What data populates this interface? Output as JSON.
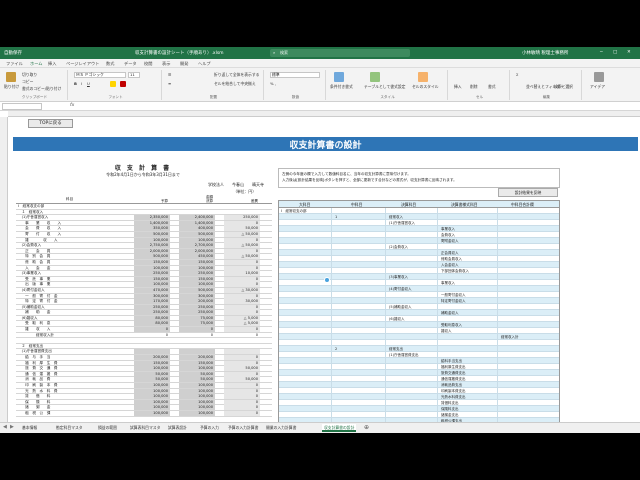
{
  "window": {
    "autosave": "自動保存",
    "title": "収支計算書の設計シート（手順あり）.xlsm",
    "search_placeholder": "検索",
    "user": "小林敏晴 税理士事務所"
  },
  "ribbon_tabs": [
    "ファイル",
    "ホーム",
    "挿入",
    "ページレイアウト",
    "数式",
    "データ",
    "校閲",
    "表示",
    "開発",
    "ヘルプ"
  ],
  "ribbon": {
    "paste": "貼り付け",
    "cut": "切り取り",
    "copy": "コピー",
    "format_painter": "書式のコピー/貼り付け",
    "clipboard": "クリップボード",
    "font_name": "ＭＳ Ｐゴシック",
    "font_size": "11",
    "font": "フォント",
    "wrap_text": "折り返して全体を表示する",
    "merge_center": "セルを結合して中央揃え",
    "alignment": "配置",
    "number_format": "標準",
    "number": "数値",
    "conditional_format": "条件付き書式",
    "format_as_table": "テーブルとして書式設定",
    "cell_styles": "セルのスタイル",
    "styles": "スタイル",
    "insert": "挿入",
    "delete": "削除",
    "format": "書式",
    "cells": "セル",
    "sort_filter": "並べ替えとフィルター",
    "find_select": "検索と選択",
    "editing": "編集",
    "ideas": "アイデア"
  },
  "formula_bar": {
    "fx": "fx"
  },
  "sheet": {
    "top_button": "TOPに戻る",
    "banner_title": "収支計算書の設計"
  },
  "report": {
    "title": "収 支 計 算 書",
    "period": "令和2年4月1日から令和3年3月31日まで",
    "org": "学校法人　　今春山　　晴天寺",
    "unit": "（単位：円）",
    "col_group": "金額",
    "col_item": "科目",
    "col1": "予算",
    "col2": "決算",
    "col3": "差異",
    "rows": [
      {
        "label": "Ⅰ　経常収支の部",
        "v1": "",
        "v2": "",
        "v3": "",
        "gray": false
      },
      {
        "label": "　１　経常収入",
        "v1": "",
        "v2": "",
        "v3": "",
        "gray": false
      },
      {
        "label": "　(1)庁舎運営収入",
        "v1": "2,350,000",
        "v2": "2,400,000",
        "v3": "250,000",
        "gray": true
      },
      {
        "label": "　　事　　業　　収　　入",
        "v1": "1,400,000",
        "v2": "1,400,000",
        "v3": "0",
        "gray": true
      },
      {
        "label": "　　会　　費　　収　　入",
        "v1": "350,000",
        "v2": "400,000",
        "v3": "50,000",
        "gray": true
      },
      {
        "label": "　　寄　　付　　収　　入",
        "v1": "500,000",
        "v2": "500,000",
        "v3": "△ 50,000",
        "gray": true
      },
      {
        "label": "　　雑　　　　収　　入",
        "v1": "100,000",
        "v2": "100,000",
        "v3": "0",
        "gray": true
      },
      {
        "label": "　(2)会費収入",
        "v1": "2,750,000",
        "v2": "2,700,000",
        "v3": "△ 50,000",
        "gray": true
      },
      {
        "label": "　　正　　会　　員",
        "v1": "2,000,000",
        "v2": "2,000,000",
        "v3": "0",
        "gray": true
      },
      {
        "label": "　　特　別　会　員",
        "v1": "500,000",
        "v2": "450,000",
        "v3": "△ 50,000",
        "gray": true
      },
      {
        "label": "　　賛　助　会　員",
        "v1": "150,000",
        "v2": "150,000",
        "v3": "0",
        "gray": true
      },
      {
        "label": "　　入　　会　　金",
        "v1": "100,000",
        "v2": "100,000",
        "v3": "0",
        "gray": true
      },
      {
        "label": "　(3)事業収入",
        "v1": "250,000",
        "v2": "250,000",
        "v3": "10,000",
        "gray": true
      },
      {
        "label": "　　受　託　事　業",
        "v1": "150,000",
        "v2": "150,000",
        "v3": "0",
        "gray": true
      },
      {
        "label": "　　出　版　事　業",
        "v1": "100,000",
        "v2": "100,000",
        "v3": "0",
        "gray": true
      },
      {
        "label": "　(4)寄付金収入",
        "v1": "470,000",
        "v2": "500,000",
        "v3": "△ 30,000",
        "gray": true
      },
      {
        "label": "　　一　般　寄　付　金",
        "v1": "300,000",
        "v2": "300,000",
        "v3": "0",
        "gray": true
      },
      {
        "label": "　　特　定　寄　付　金",
        "v1": "170,000",
        "v2": "200,000",
        "v3": "30,000",
        "gray": true
      },
      {
        "label": "　(5)補助金収入",
        "v1": "250,000",
        "v2": "250,000",
        "v3": "0",
        "gray": true
      },
      {
        "label": "　　補　　助　　金",
        "v1": "250,000",
        "v2": "250,000",
        "v3": "0",
        "gray": true
      },
      {
        "label": "　(6)雑収入",
        "v1": "80,000",
        "v2": "75,000",
        "v3": "△ 5,000",
        "gray": true
      },
      {
        "label": "　　受　取　利　息",
        "v1": "80,000",
        "v2": "75,000",
        "v3": "△ 5,000",
        "gray": true
      },
      {
        "label": "　　雑　　収　　入",
        "v1": "0",
        "v2": "0",
        "v3": "0",
        "gray": true
      },
      {
        "label": "　　　　　経常収入計",
        "v1": "0",
        "v2": "0",
        "v3": "0",
        "gray": false
      },
      {
        "label": "",
        "v1": "",
        "v2": "",
        "v3": "",
        "gray": false
      },
      {
        "label": "　２　経常支出",
        "v1": "",
        "v2": "",
        "v3": "",
        "gray": false
      },
      {
        "label": "　(1)庁舎運営費支出",
        "v1": "",
        "v2": "",
        "v3": "",
        "gray": true
      },
      {
        "label": "　　給　与　手　当",
        "v1": "200,000",
        "v2": "200,000",
        "v3": "0",
        "gray": true
      },
      {
        "label": "　　福　利　厚　生　費",
        "v1": "150,000",
        "v2": "150,000",
        "v3": "0",
        "gray": true
      },
      {
        "label": "　　旅　費　交　通　費",
        "v1": "100,000",
        "v2": "100,000",
        "v3": "50,000",
        "gray": true
      },
      {
        "label": "　　通　信　運　搬　費",
        "v1": "50,000",
        "v2": "50,000",
        "v3": "0",
        "gray": true
      },
      {
        "label": "　　消　耗　品　費",
        "v1": "50,000",
        "v2": "50,000",
        "v3": "50,000",
        "gray": true
      },
      {
        "label": "　　印　刷　製　本　費",
        "v1": "100,000",
        "v2": "100,000",
        "v3": "0",
        "gray": true
      },
      {
        "label": "　　光　熱　水　料　費",
        "v1": "100,000",
        "v2": "100,000",
        "v3": "0",
        "gray": true
      },
      {
        "label": "　　賃　　借　　料",
        "v1": "100,000",
        "v2": "100,000",
        "v3": "0",
        "gray": true
      },
      {
        "label": "　　保　　険　　料",
        "v1": "100,000",
        "v2": "100,000",
        "v3": "0",
        "gray": true
      },
      {
        "label": "　　諸　　謝　　金",
        "v1": "100,000",
        "v2": "100,000",
        "v3": "0",
        "gray": true
      },
      {
        "label": "　　租　税　公　課",
        "v1": "100,000",
        "v2": "100,000",
        "v3": "0",
        "gray": true
      }
    ]
  },
  "panel": {
    "note1": "左側の今年度の欄で入力して数値科目名に、当年の収支計算書に意味付けます。",
    "note2": "入力後は[設計結果を反映]ボタンを押すと、全部に更新です合計などの書式が、収支計算書に反映されます。",
    "apply_button": "設計結果を反映",
    "headers": [
      "大科目",
      "中科目",
      "決算科目",
      "決算書様式科目",
      "中科目合計欄"
    ],
    "rows": [
      {
        "c0": "Ⅰ　経常収支の部",
        "c1": "",
        "c2": "",
        "c3": "",
        "c4": "",
        "hl": false
      },
      {
        "c0": "",
        "c1": "1",
        "c2": "経常収入",
        "c3": "",
        "c4": "",
        "hl": true
      },
      {
        "c0": "",
        "c1": "",
        "c2": "(1)庁舎運営収入",
        "c3": "",
        "c4": "",
        "hl": false
      },
      {
        "c0": "",
        "c1": "",
        "c2": "",
        "c3": "事業収入",
        "c4": "",
        "hl": true
      },
      {
        "c0": "",
        "c1": "",
        "c2": "",
        "c3": "会費収入",
        "c4": "",
        "hl": false
      },
      {
        "c0": "",
        "c1": "",
        "c2": "",
        "c3": "寄附金収入",
        "c4": "",
        "hl": true
      },
      {
        "c0": "",
        "c1": "",
        "c2": "(2)会費収入",
        "c3": "",
        "c4": "",
        "hl": false
      },
      {
        "c0": "",
        "c1": "",
        "c2": "",
        "c3": "正会員収入",
        "c4": "",
        "hl": true
      },
      {
        "c0": "",
        "c1": "",
        "c2": "",
        "c3": "賛助会員収入",
        "c4": "",
        "hl": false
      },
      {
        "c0": "",
        "c1": "",
        "c2": "",
        "c3": "入会金収入",
        "c4": "",
        "hl": true
      },
      {
        "c0": "",
        "c1": "",
        "c2": "",
        "c3": "下部団体会費収入",
        "c4": "",
        "hl": false
      },
      {
        "c0": "",
        "c1": "",
        "c2": "(3)事業収入",
        "c3": "",
        "c4": "",
        "hl": true
      },
      {
        "c0": "",
        "c1": "",
        "c2": "",
        "c3": "事業収入",
        "c4": "",
        "hl": false
      },
      {
        "c0": "",
        "c1": "",
        "c2": "(4)寄付金収入",
        "c3": "",
        "c4": "",
        "hl": true
      },
      {
        "c0": "",
        "c1": "",
        "c2": "",
        "c3": "一般寄付金収入",
        "c4": "",
        "hl": false
      },
      {
        "c0": "",
        "c1": "",
        "c2": "",
        "c3": "特定寄付金収入",
        "c4": "",
        "hl": true
      },
      {
        "c0": "",
        "c1": "",
        "c2": "(5)補助金収入",
        "c3": "",
        "c4": "",
        "hl": false
      },
      {
        "c0": "",
        "c1": "",
        "c2": "",
        "c3": "補助金収入",
        "c4": "",
        "hl": true
      },
      {
        "c0": "",
        "c1": "",
        "c2": "(6)雑収入",
        "c3": "",
        "c4": "",
        "hl": false
      },
      {
        "c0": "",
        "c1": "",
        "c2": "",
        "c3": "受取利息収入",
        "c4": "",
        "hl": true
      },
      {
        "c0": "",
        "c1": "",
        "c2": "",
        "c3": "雑収入",
        "c4": "",
        "hl": false
      },
      {
        "c0": "",
        "c1": "",
        "c2": "",
        "c3": "",
        "c4": "経常収入計",
        "hl": true
      },
      {
        "c0": "",
        "c1": "",
        "c2": "",
        "c3": "",
        "c4": "",
        "hl": false
      },
      {
        "c0": "",
        "c1": "2",
        "c2": "経常支出",
        "c3": "",
        "c4": "",
        "hl": true
      },
      {
        "c0": "",
        "c1": "",
        "c2": "(1)庁舎運営費支出",
        "c3": "",
        "c4": "",
        "hl": false
      },
      {
        "c0": "",
        "c1": "",
        "c2": "",
        "c3": "給料手当支出",
        "c4": "",
        "hl": true
      },
      {
        "c0": "",
        "c1": "",
        "c2": "",
        "c3": "福利厚生費支出",
        "c4": "",
        "hl": false
      },
      {
        "c0": "",
        "c1": "",
        "c2": "",
        "c3": "旅費交通費支出",
        "c4": "",
        "hl": true
      },
      {
        "c0": "",
        "c1": "",
        "c2": "",
        "c3": "通信運搬費支出",
        "c4": "",
        "hl": false
      },
      {
        "c0": "",
        "c1": "",
        "c2": "",
        "c3": "消耗品費支出",
        "c4": "",
        "hl": true
      },
      {
        "c0": "",
        "c1": "",
        "c2": "",
        "c3": "印刷製本費支出",
        "c4": "",
        "hl": false
      },
      {
        "c0": "",
        "c1": "",
        "c2": "",
        "c3": "光熱水料費支出",
        "c4": "",
        "hl": true
      },
      {
        "c0": "",
        "c1": "",
        "c2": "",
        "c3": "賃借料支出",
        "c4": "",
        "hl": false
      },
      {
        "c0": "",
        "c1": "",
        "c2": "",
        "c3": "保険料支出",
        "c4": "",
        "hl": true
      },
      {
        "c0": "",
        "c1": "",
        "c2": "",
        "c3": "諸謝金支出",
        "c4": "",
        "hl": false
      },
      {
        "c0": "",
        "c1": "",
        "c2": "",
        "c3": "租税公課支出",
        "c4": "",
        "hl": true
      }
    ]
  },
  "sheet_tabs": [
    "基本情報",
    "勘定科目マスタ",
    "損益の範囲",
    "試算表科目マスタ",
    "試算表設計",
    "予算の入力",
    "予算の入力計算書",
    "開業の入力計算書",
    "収支計算書の設計"
  ],
  "active_sheet_tab": "収支計算書の設計",
  "colors": {
    "excel_green": "#217346",
    "banner_blue": "#2e75b6",
    "panel_highlight": "#dbeef7"
  }
}
